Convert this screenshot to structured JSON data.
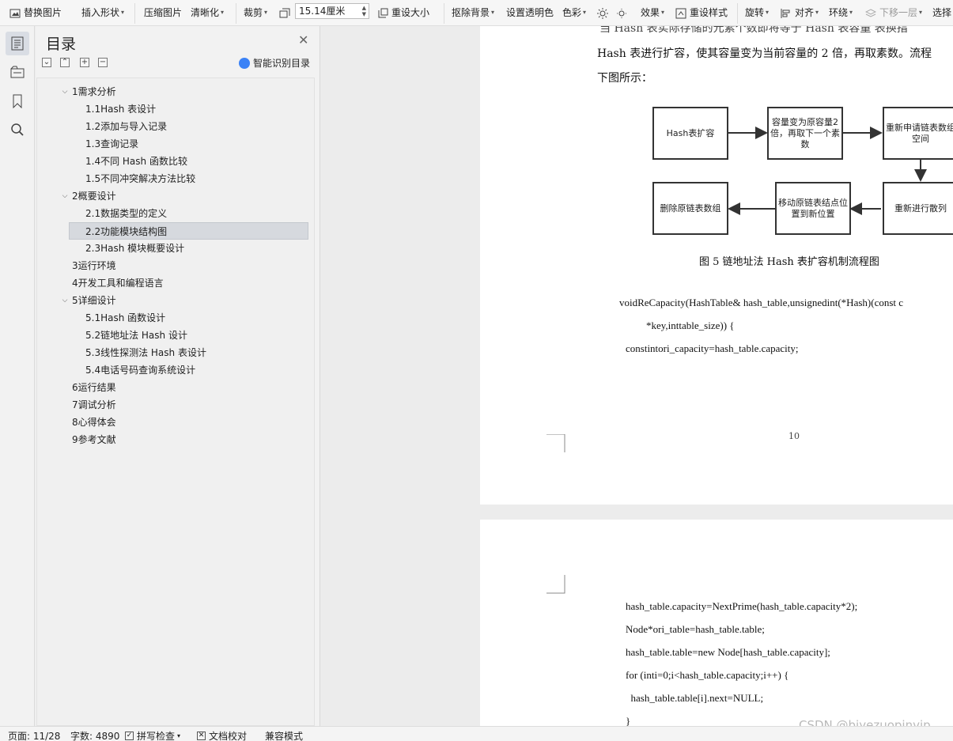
{
  "toolbar": {
    "replace_image": "替换图片",
    "insert_shape": "插入形状",
    "compress_image": "压缩图片",
    "sharpen": "清晰化",
    "crop": "裁剪",
    "size_value": "15.14厘米",
    "reset_size": "重设大小",
    "remove_bg": "抠除背景",
    "set_transparent": "设置透明色",
    "color": "色彩",
    "effects": "效果",
    "reset_style": "重设样式",
    "rotate": "旋转",
    "align": "对齐",
    "wrap": "环绕",
    "send_backward": "下移一层",
    "select": "选择"
  },
  "toc": {
    "title": "目录",
    "smart_label": "智能识别目录",
    "items": [
      {
        "label": "1需求分析",
        "level": 1,
        "expanded": true
      },
      {
        "label": "1.1Hash 表设计",
        "level": 2
      },
      {
        "label": "1.2添加与导入记录",
        "level": 2
      },
      {
        "label": "1.3查询记录",
        "level": 2
      },
      {
        "label": "1.4不同 Hash 函数比较",
        "level": 2
      },
      {
        "label": "1.5不同冲突解决方法比较",
        "level": 2
      },
      {
        "label": "2概要设计",
        "level": 1,
        "expanded": true
      },
      {
        "label": "2.1数据类型的定义",
        "level": 2
      },
      {
        "label": "2.2功能模块结构图",
        "level": 2,
        "selected": true
      },
      {
        "label": "2.3Hash 模块概要设计",
        "level": 2
      },
      {
        "label": "3运行环境",
        "level": 1
      },
      {
        "label": "4开发工具和编程语言",
        "level": 1
      },
      {
        "label": "5详细设计",
        "level": 1,
        "expanded": true
      },
      {
        "label": "5.1Hash 函数设计",
        "level": 2
      },
      {
        "label": "5.2链地址法 Hash 设计",
        "level": 2
      },
      {
        "label": "5.3线性探测法 Hash 表设计",
        "level": 2
      },
      {
        "label": "5.4电话号码查询系统设计",
        "level": 2
      },
      {
        "label": "6运行结果",
        "level": 1
      },
      {
        "label": "7调试分析",
        "level": 1
      },
      {
        "label": "8心得体会",
        "level": 1
      },
      {
        "label": "9参考文献",
        "level": 1
      }
    ]
  },
  "doc": {
    "top_partial": "当 Hash 表实际存储的元素个数即将等于 Hash 表容量 表换指",
    "line1": "Hash 表进行扩容，使其容量变为当前容量的 2 倍，再取素数。流程",
    "line2": "下图所示：",
    "flow": {
      "box1": "Hash表扩容",
      "box2": "容量变为原容量2倍，再取下一个素数",
      "box3": "重新申请链表数组空间",
      "box4": "重新进行散列",
      "box5": "移动原链表结点位置到新位置",
      "box6": "删除原链表数组"
    },
    "caption": "图 5 链地址法 Hash 表扩容机制流程图",
    "code1": "voidReCapacity(HashTable& hash_table,unsignedint(*Hash)(const c",
    "code2": "*key,inttable_size)) {",
    "code3": "constintori_capacity=hash_table.capacity;",
    "page_number": "10",
    "page2_code": [
      "hash_table.capacity=NextPrime(hash_table.capacity*2);",
      "Node*ori_table=hash_table.table;",
      "hash_table.table=new Node[hash_table.capacity];",
      "for (inti=0;i<hash_table.capacity;i++) {",
      "  hash_table.table[i].next=NULL;",
      "}"
    ]
  },
  "status": {
    "page": "页面: 11/28",
    "words": "字数: 4890",
    "spell": "拼写检查",
    "proof": "文档校对",
    "compat": "兼容模式"
  },
  "watermark": "CSDN @biyezuopinvip"
}
